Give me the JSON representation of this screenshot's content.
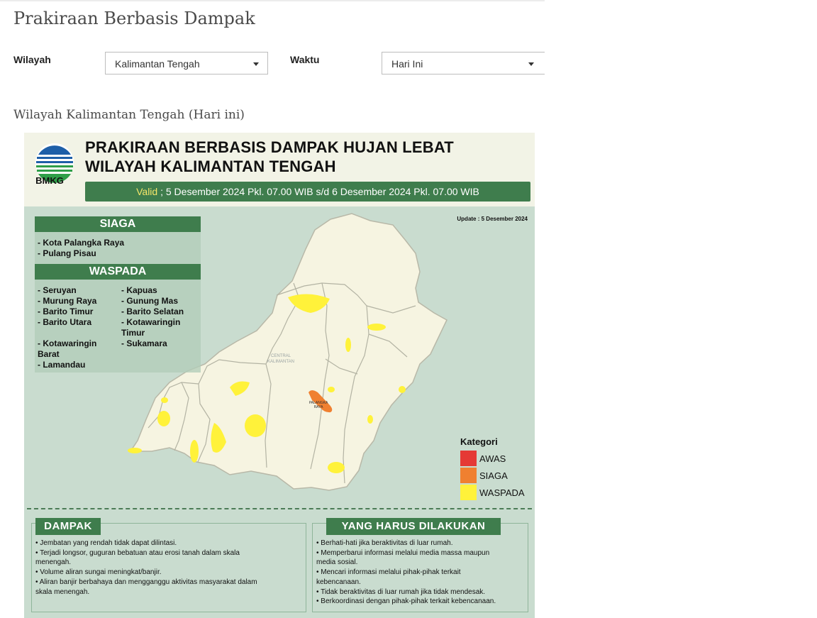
{
  "page": {
    "title": "Prakiraan Berbasis Dampak",
    "section_title": "Wilayah Kalimantan Tengah (Hari ini)"
  },
  "filters": {
    "region_label": "Wilayah",
    "region_value": "Kalimantan Tengah",
    "time_label": "Waktu",
    "time_value": "Hari Ini"
  },
  "infographic": {
    "logo_text": "BMKG",
    "title_line1": "PRAKIRAAN BERBASIS DAMPAK HUJAN LEBAT",
    "title_line2": "WILAYAH KALIMANTAN TENGAH",
    "valid_label": "Valid",
    "valid_text": " ; 5 Desember 2024 Pkl. 07.00 WIB s/d 6 Desember 2024 Pkl. 07.00 WIB",
    "update_text": "Update : 5 Desember 2024",
    "siaga": {
      "heading": "SIAGA",
      "items": [
        "- Kota Palangka Raya",
        "- Pulang Pisau"
      ]
    },
    "waspada": {
      "heading": "WASPADA",
      "col1": [
        "- Seruyan",
        "- Murung Raya",
        "- Barito Timur",
        "- Barito Utara"
      ],
      "col1b": [
        "- Kotawaringin",
        "Barat",
        "- Lamandau"
      ],
      "col2": [
        "- Kapuas",
        "- Gunung Mas",
        "- Barito Selatan",
        "- Kotawaringin",
        "Timur",
        "- Sukamara"
      ]
    },
    "map_label": [
      "CENTRAL",
      "KALIMANTAN"
    ],
    "city_label": [
      "PALANGKA",
      "RAYA"
    ],
    "legend": {
      "title": "Kategori",
      "items": [
        {
          "label": "AWAS",
          "color": "#e53935"
        },
        {
          "label": "SIAGA",
          "color": "#f08030"
        },
        {
          "label": "WASPADA",
          "color": "#fff23a"
        }
      ]
    },
    "dampak": {
      "heading": "DAMPAK",
      "lines": [
        "• Jembatan yang rendah tidak dapat dilintasi.",
        "• Terjadi longsor, guguran bebatuan atau erosi tanah dalam skala",
        "menengah.",
        "• Volume aliran sungai meningkat/banjir.",
        "• Aliran banjir berbahaya dan mengganggu aktivitas masyarakat dalam",
        "skala menengah."
      ]
    },
    "todo": {
      "heading": "YANG HARUS DILAKUKAN",
      "lines": [
        "• Berhati-hati jika beraktivitas di luar rumah.",
        "• Memperbarui informasi melalui media massa maupun",
        "media sosial.",
        "• Mencari informasi melalui pihak-pihak terkait",
        "kebencanaan.",
        "• Tidak beraktivitas di luar rumah jika tidak mendesak.",
        "• Berkoordinasi dengan pihak-pihak terkait kebencanaan."
      ]
    }
  }
}
